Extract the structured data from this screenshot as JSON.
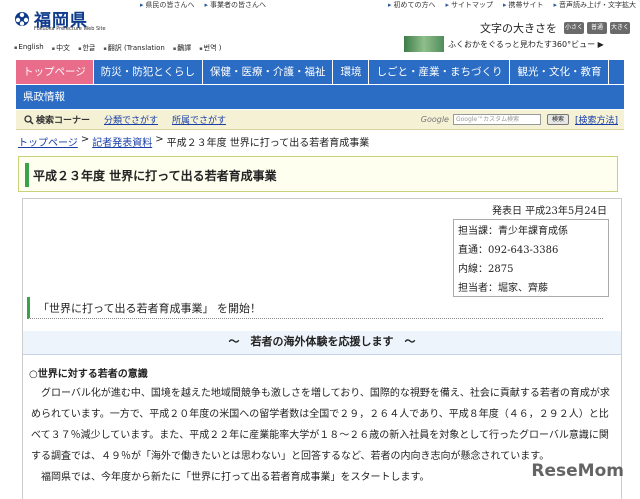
{
  "header": {
    "logo_text": "福岡県",
    "logo_sub": "Fukuoka Prefecture Web Site",
    "top_links_left": [
      "県民の皆さんへ",
      "事業者の皆さんへ"
    ],
    "top_links_right": [
      "初めての方へ",
      "サイトマップ",
      "携帯サイト",
      "音声読み上げ・文字拡大"
    ],
    "languages": [
      "English",
      "中文",
      "한글",
      "翻訳 (Translation",
      "飜譯",
      "번역 )"
    ],
    "font_size_label": "文字の大きさを",
    "font_size_buttons": [
      "小さく",
      "普通",
      "大きく"
    ],
    "banner_text": "ふくおかをぐるっと見わたす360°ビュー ▶"
  },
  "nav": {
    "row1": [
      "トップページ",
      "防災・防犯とくらし",
      "保健・医療・介護・福祉",
      "環境",
      "しごと・産業・まちづくり",
      "観光・文化・教育"
    ],
    "row2": [
      "県政情報"
    ]
  },
  "search": {
    "corner_label": "検索コーナー",
    "by_category": "分類でさがす",
    "by_department": "所属でさがす",
    "google_label": "Google",
    "input_placeholder": "Google™カスタム検索",
    "button_label": "検索",
    "how_to": "[検索方法]"
  },
  "breadcrumb": {
    "home": "トップページ",
    "sep1": ">",
    "press": "記者発表資料",
    "sep2": ">",
    "current": "平成２３年度 世界に打って出る若者育成事業"
  },
  "page": {
    "title": "平成２３年度 世界に打って出る若者育成事業",
    "date": "発表日 平成23年5月24日",
    "contact": [
      "担当課：青少年課育成係",
      "直通：092-643-3386",
      "内線：2875",
      "担当者：堀家、齊藤"
    ],
    "section_heading": "「世界に打って出る若者育成事業」 を開始！",
    "sub_heading": "～　若者の海外体験を応援します　～",
    "section_label": "○世界に対する若者の意識",
    "paragraph1": "グローバル化が進む中、国境を越えた地域間競争も激しさを増しており、国際的な視野を備え、社会に貢献する若者の育成が求められています。一方で、平成２０年度の米国への留学者数は全国で２９，２６４人であり、平成８年度（４６，２９２人）と比べて３７％減少しています。また、平成２２年に産業能率大学が１８～２６歳の新入社員を対象として行ったグローバル意識に関する調査では、４９％が「海外で働きたいとは思わない」と回答するなど、若者の内向き志向が懸念されています。",
    "paragraph2": "福岡県では、今年度から新たに「世界に打って出る若者育成事業」をスタートします。"
  },
  "watermark": "ReseMom"
}
